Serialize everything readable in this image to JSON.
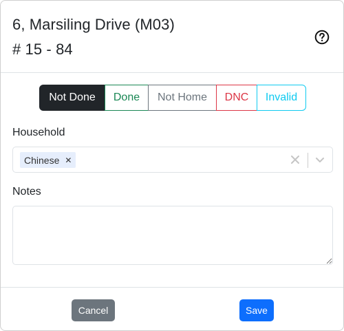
{
  "header": {
    "address": "6, Marsiling Drive (M03)",
    "unit": "# 15 - 84"
  },
  "status": {
    "options": [
      "Not Done",
      "Done",
      "Not Home",
      "DNC",
      "Invalid"
    ],
    "selected": "Not Done"
  },
  "household": {
    "label": "Household",
    "tags": [
      "Chinese"
    ]
  },
  "notes": {
    "label": "Notes",
    "value": ""
  },
  "footer": {
    "cancel_label": "Cancel",
    "save_label": "Save"
  },
  "colors": {
    "primary": "#0d6efd",
    "secondary": "#6c757d",
    "success": "#198754",
    "danger": "#dc3545",
    "info": "#0dcaf0",
    "dark": "#212529"
  },
  "icons": {
    "help": "question-circle-icon",
    "tag_remove": "close-icon",
    "clear": "clear-icon",
    "dropdown": "chevron-down-icon"
  }
}
